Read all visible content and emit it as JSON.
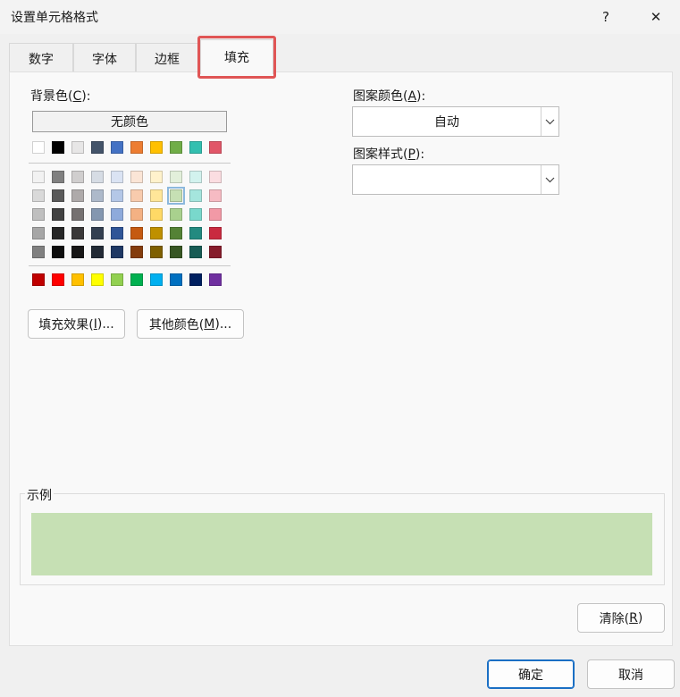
{
  "window": {
    "title": "设置单元格格式",
    "help_glyph": "?",
    "close_glyph": "✕"
  },
  "tabs": [
    {
      "label": "数字"
    },
    {
      "label": "字体"
    },
    {
      "label": "边框"
    },
    {
      "label": "填充",
      "active": true
    }
  ],
  "background": {
    "label": "背景色",
    "accel": "C",
    "no_color_label": "无颜色",
    "selected_color": "#c6e0b4",
    "theme_row": [
      "#ffffff",
      "#000000",
      "#e7e6e6",
      "#44546a",
      "#4472c4",
      "#ed7d31",
      "#ffc000",
      "#70ad47",
      "#33bfb0",
      "#e15668"
    ],
    "tint_rows": [
      [
        "#f2f2f2",
        "#808080",
        "#d0cece",
        "#d6dce4",
        "#dae3f3",
        "#fbe5d6",
        "#fff2cc",
        "#e2efda",
        "#d2f2ee",
        "#fbdde1"
      ],
      [
        "#d9d9d9",
        "#595959",
        "#aeaaaa",
        "#adb9ca",
        "#b4c7e7",
        "#f8cbad",
        "#ffe699",
        "#c6e0b4",
        "#a5e5dd",
        "#f6bbc3"
      ],
      [
        "#bfbfbf",
        "#404040",
        "#757171",
        "#8497b0",
        "#8eaadb",
        "#f4b183",
        "#ffd966",
        "#a9d18e",
        "#79d8cc",
        "#f299a6"
      ],
      [
        "#a6a6a6",
        "#262626",
        "#3a3838",
        "#333f50",
        "#2f5597",
        "#c55a11",
        "#bf9000",
        "#548235",
        "#238a80",
        "#c92a40"
      ],
      [
        "#808080",
        "#0d0d0d",
        "#171616",
        "#222a35",
        "#1f3864",
        "#843c0c",
        "#7f6000",
        "#375623",
        "#175c55",
        "#861c2b"
      ]
    ],
    "standard_row": [
      "#c00000",
      "#ff0000",
      "#ffc000",
      "#ffff00",
      "#92d050",
      "#00b050",
      "#00b0f0",
      "#0070c0",
      "#002060",
      "#7030a0"
    ]
  },
  "buttons": {
    "fill_effects": {
      "text": "填充效果(",
      "accel": "I",
      "suffix": ")..."
    },
    "more_colors": {
      "text": "其他颜色(",
      "accel": "M",
      "suffix": ")..."
    },
    "clear": {
      "text": "清除(",
      "accel": "R",
      "suffix": ")"
    },
    "ok": "确定",
    "cancel": "取消"
  },
  "pattern": {
    "color_label": "图案颜色",
    "color_accel": "A",
    "color_value": "自动",
    "style_label": "图案样式",
    "style_accel": "P",
    "style_value": ""
  },
  "sample": {
    "label": "示例",
    "color": "#c6e0b4"
  }
}
